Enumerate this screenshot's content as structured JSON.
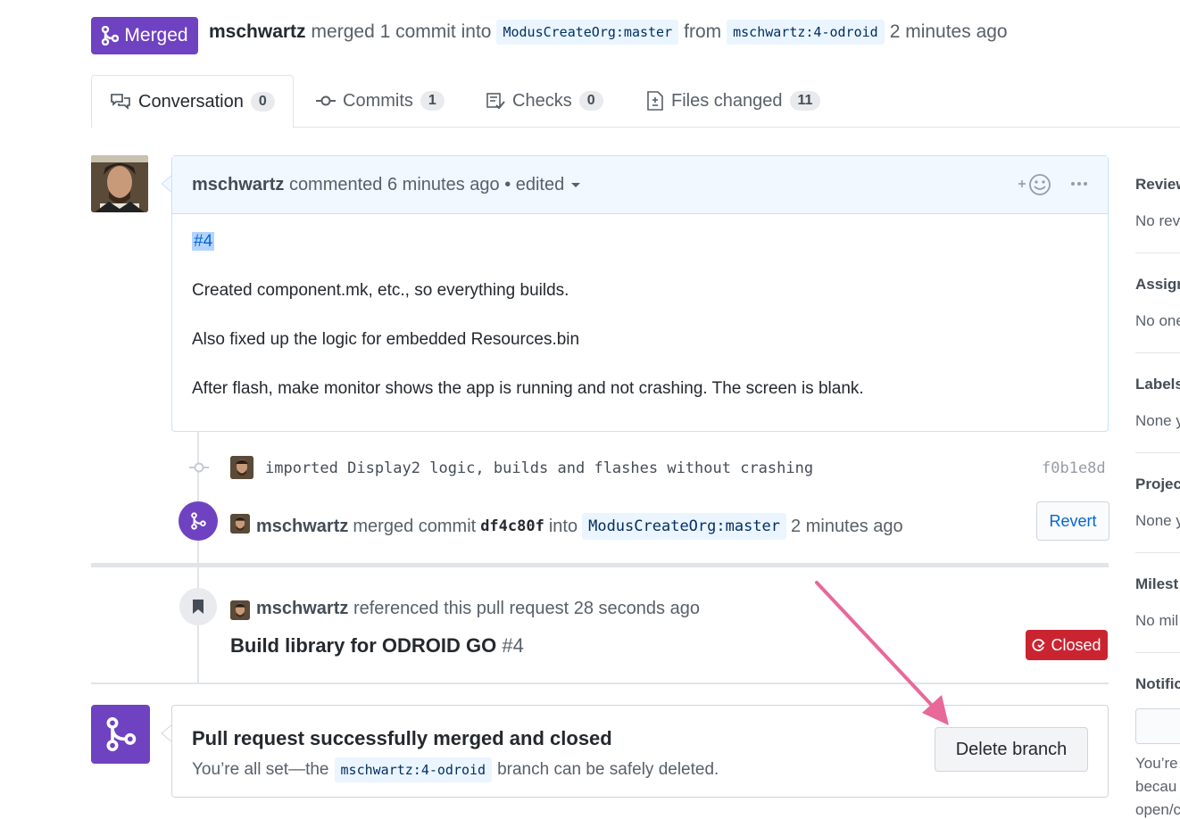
{
  "header": {
    "status_label": "Merged",
    "author": "mschwartz",
    "merged_text": "merged 1 commit into",
    "base_branch": "ModusCreateOrg:master",
    "from_text": "from",
    "head_branch": "mschwartz:4-odroid",
    "time": "2 minutes ago"
  },
  "tabs": [
    {
      "label": "Conversation",
      "count": "0"
    },
    {
      "label": "Commits",
      "count": "1"
    },
    {
      "label": "Checks",
      "count": "0"
    },
    {
      "label": "Files changed",
      "count": "11"
    }
  ],
  "comment": {
    "author": "mschwartz",
    "action": "commented 6 minutes ago",
    "edited": "• edited",
    "issue_ref": "#4",
    "paragraphs": [
      "Created component.mk, etc., so everything builds.",
      "Also fixed up the logic for embedded Resources.bin",
      "After flash, make monitor shows the app is running and not crashing. The screen is blank."
    ]
  },
  "commit": {
    "message": "imported Display2 logic, builds and flashes without crashing",
    "sha": "f0b1e8d"
  },
  "merge_event": {
    "author": "mschwartz",
    "text": "merged commit",
    "sha": "df4c80f",
    "into": "into",
    "branch": "ModusCreateOrg:master",
    "time": "2 minutes ago",
    "revert_label": "Revert"
  },
  "reference_event": {
    "author": "mschwartz",
    "text": "referenced this pull request 28 seconds ago",
    "title": "Build library for ODROID GO",
    "number": "#4",
    "status": "Closed"
  },
  "merge_box": {
    "title": "Pull request successfully merged and closed",
    "text_before": "You’re all set—the",
    "branch": "mschwartz:4-odroid",
    "text_after": "branch can be safely deleted.",
    "button": "Delete branch"
  },
  "sidebar": [
    {
      "label": "Review",
      "value": "No rev"
    },
    {
      "label": "Assign",
      "value": "No one"
    },
    {
      "label": "Labels",
      "value": "None y"
    },
    {
      "label": "Projec",
      "value": "None y"
    },
    {
      "label": "Milest",
      "value": "No mil"
    },
    {
      "label": "Notific",
      "value": ""
    }
  ],
  "sidebar_notify_text": [
    "You’re",
    "becau",
    "open/c"
  ],
  "colors": {
    "merged": "#6f42c1",
    "closed": "#cb2431",
    "link": "#0366d6",
    "arrow": "#e8689a"
  }
}
